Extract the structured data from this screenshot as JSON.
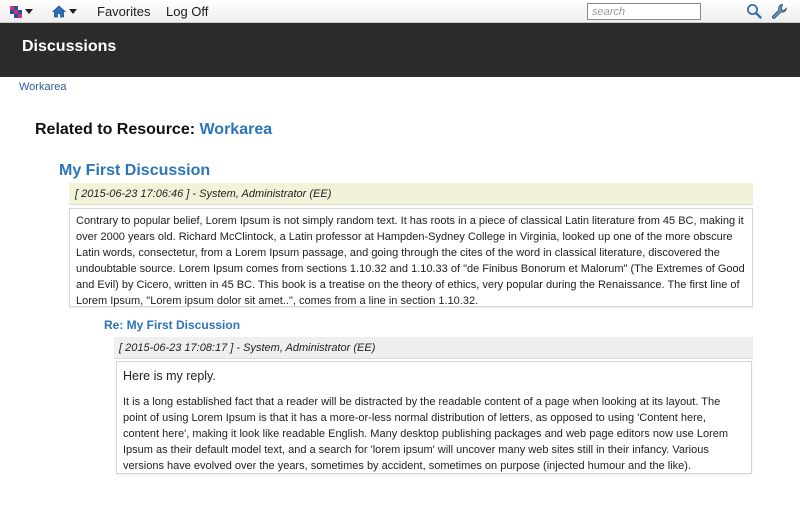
{
  "toolbar": {
    "favorites_label": "Favorites",
    "logoff_label": "Log Off",
    "search_placeholder": "search",
    "icons": [
      "apps-grid-icon",
      "home-icon",
      "search-icon",
      "wrench-icon"
    ]
  },
  "header": {
    "title": "Discussions"
  },
  "breadcrumb": {
    "label": "Workarea"
  },
  "related": {
    "prefix": "Related to Resource: ",
    "resource": "Workarea"
  },
  "discussion": {
    "title": "My First Discussion",
    "meta": "[ 2015-06-23 17:06:46 ] - System, Administrator (EE)",
    "body": "Contrary to popular belief, Lorem Ipsum is not simply random text. It has roots in a piece of classical Latin literature from 45 BC, making it over 2000 years old. Richard McClintock, a Latin professor at Hampden-Sydney College in Virginia, looked up one of the more obscure Latin words, consectetur, from a Lorem Ipsum passage, and going through the cites of the word in classical literature, discovered the undoubtable source. Lorem Ipsum comes from sections 1.10.32 and 1.10.33 of \"de Finibus Bonorum et Malorum\" (The Extremes of Good and Evil) by Cicero, written in 45 BC. This book is a treatise on the theory of ethics, very popular during the Renaissance. The first line of Lorem Ipsum, \"Lorem ipsum dolor sit amet..\", comes from a line in section 1.10.32."
  },
  "reply": {
    "title": "Re: My First Discussion",
    "meta": "[ 2015-06-23 17:08:17 ] - System, Administrator (EE)",
    "lead": "Here is my reply.",
    "body": "It is a long established fact that a reader will be distracted by the readable content of a page when looking at its layout. The point of using Lorem Ipsum is that it has a more-or-less normal distribution of letters, as opposed to using 'Content here, content here', making it look like readable English. Many desktop publishing packages and web page editors now use Lorem Ipsum as their default model text, and a search for 'lorem ipsum' will uncover many web sites still in their infancy. Various versions have evolved over the years, sometimes by accident, sometimes on purpose (injected humour and the like)."
  },
  "colors": {
    "header_bg": "#2b2b2b",
    "link": "#2b75b8",
    "meta_bg": "#f2f2d8"
  }
}
